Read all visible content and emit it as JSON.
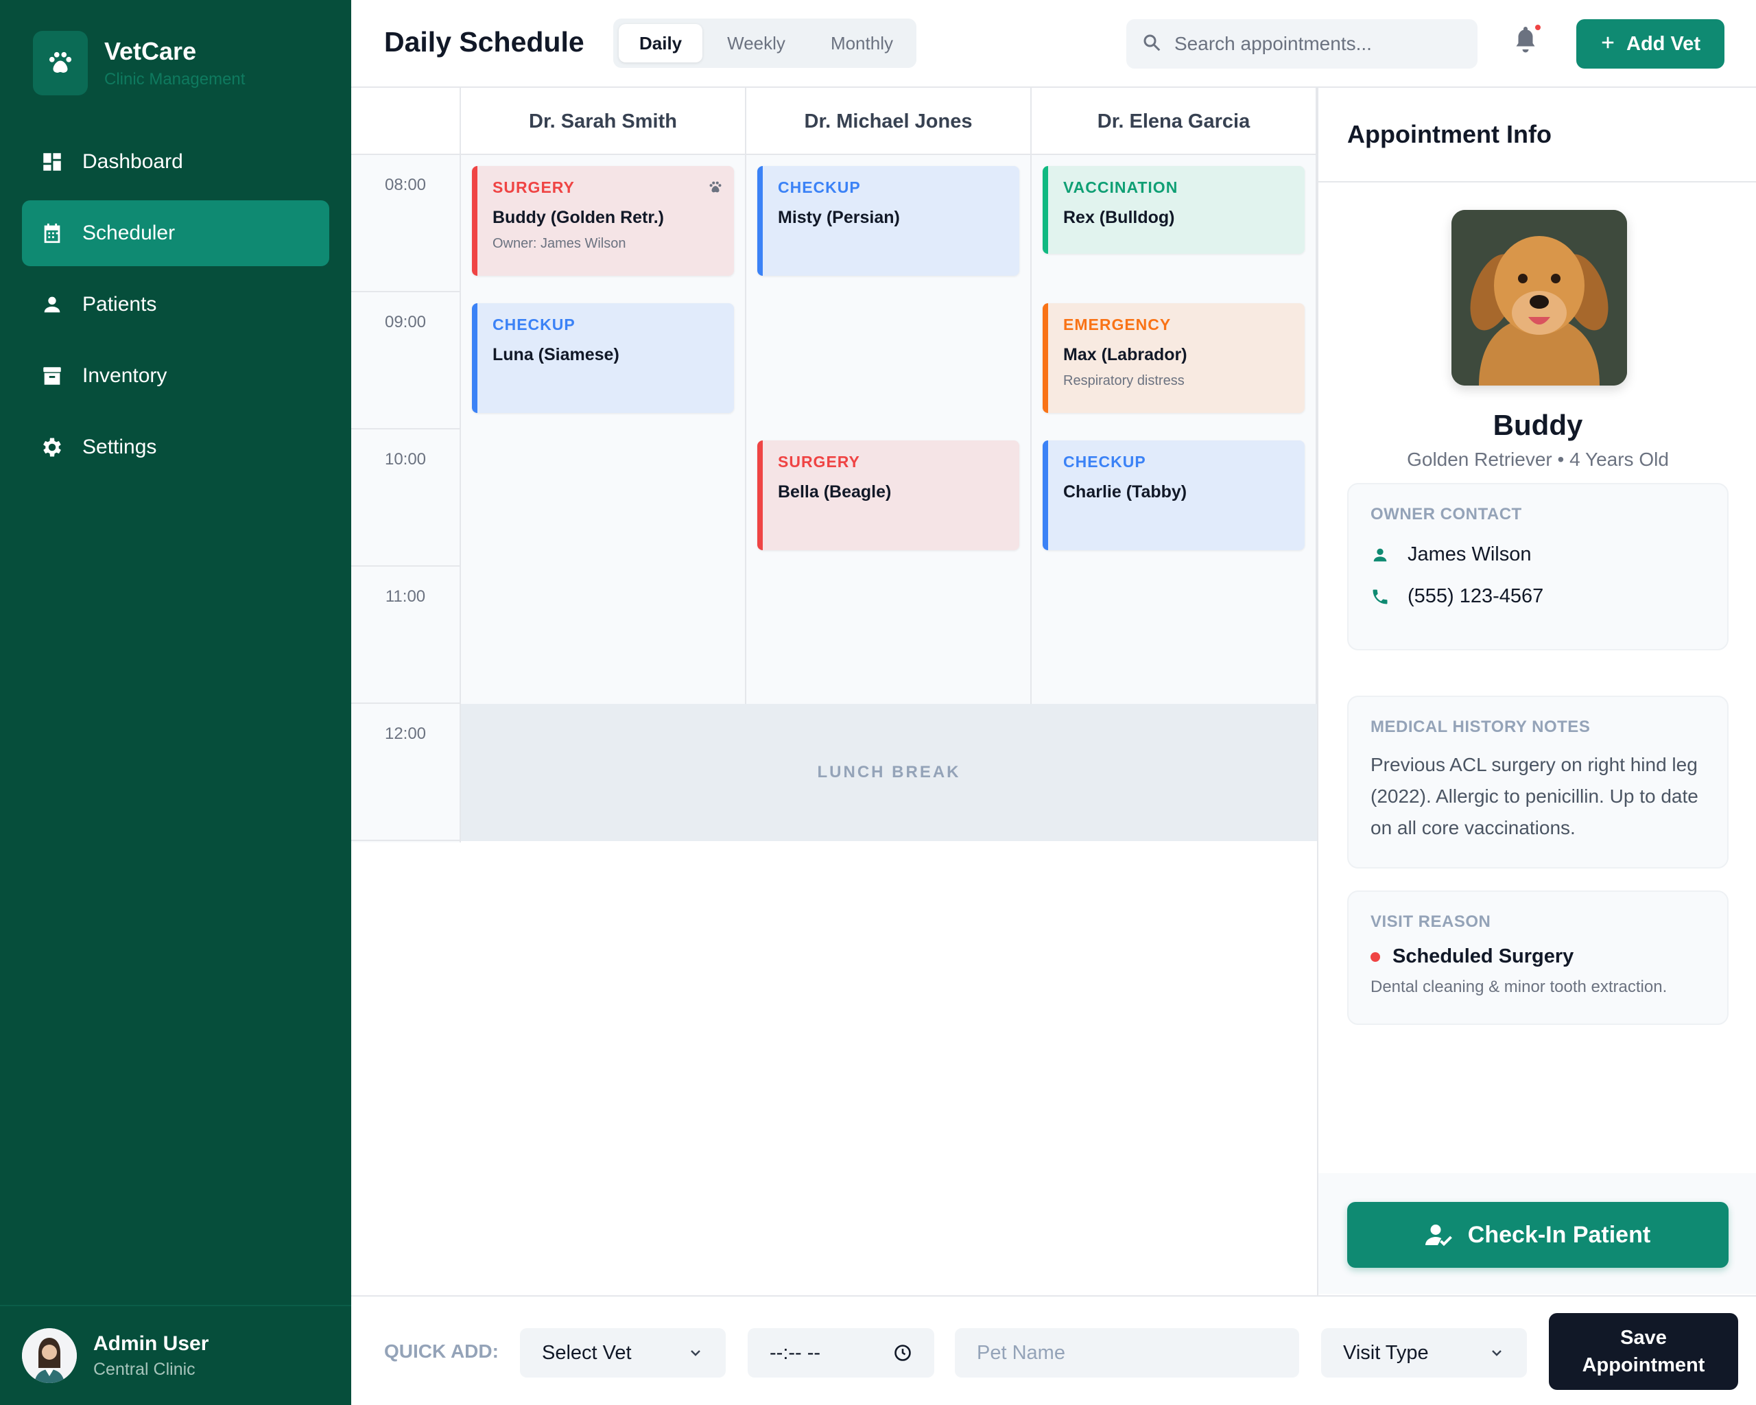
{
  "brand": {
    "title": "VetCare",
    "subtitle": "Clinic Management"
  },
  "nav": [
    {
      "label": "Dashboard",
      "icon": "dashboard-icon",
      "active": false
    },
    {
      "label": "Scheduler",
      "icon": "calendar-icon",
      "active": true
    },
    {
      "label": "Patients",
      "icon": "person-icon",
      "active": false
    },
    {
      "label": "Inventory",
      "icon": "archive-icon",
      "active": false
    },
    {
      "label": "Settings",
      "icon": "gear-icon",
      "active": false
    }
  ],
  "user": {
    "name": "Admin User",
    "location": "Central Clinic"
  },
  "header": {
    "title": "Daily Schedule",
    "views": [
      "Daily",
      "Weekly",
      "Monthly"
    ],
    "active_view": "Daily",
    "search_placeholder": "Search appointments...",
    "add_vet_label": "Add Vet"
  },
  "schedule": {
    "times": [
      "08:00",
      "09:00",
      "10:00",
      "11:00",
      "12:00"
    ],
    "vets": [
      "Dr. Sarah Smith",
      "Dr. Michael Jones",
      "Dr. Elena Garcia"
    ],
    "lunch_label": "LUNCH BREAK",
    "appointments": {
      "sarah_0800": {
        "type": "SURGERY",
        "pet": "Buddy (Golden Retr.)",
        "note": "Owner: James Wilson"
      },
      "michael_0800": {
        "type": "CHECKUP",
        "pet": "Misty (Persian)"
      },
      "elena_0800": {
        "type": "VACCINATION",
        "pet": "Rex (Bulldog)"
      },
      "sarah_0900": {
        "type": "CHECKUP",
        "pet": "Luna (Siamese)"
      },
      "elena_0900": {
        "type": "EMERGENCY",
        "pet": "Max (Labrador)",
        "note": "Respiratory distress"
      },
      "michael_1000": {
        "type": "SURGERY",
        "pet": "Bella (Beagle)"
      },
      "elena_1000": {
        "type": "CHECKUP",
        "pet": "Charlie (Tabby)"
      }
    }
  },
  "panel": {
    "title": "Appointment Info",
    "pet_name": "Buddy",
    "pet_breed": "Golden Retriever",
    "pet_age": "4 Years Old",
    "owner_title": "OWNER CONTACT",
    "owner_name": "James Wilson",
    "owner_phone": "(555) 123-4567",
    "history_title": "MEDICAL HISTORY NOTES",
    "history_text": "Previous ACL surgery on right hind leg (2022). Allergic to penicillin. Up to date on all core vaccinations.",
    "reason_title": "VISIT REASON",
    "reason": "Scheduled Surgery",
    "reason_desc": "Dental cleaning & minor tooth extraction.",
    "checkin_label": "Check-In Patient"
  },
  "quick_add": {
    "label": "QUICK ADD:",
    "vet_select": "Select Vet",
    "time_placeholder": "--:-- --",
    "pet_placeholder": "Pet Name",
    "type_select": "Visit Type",
    "save_label": "Save Appointment"
  },
  "colors": {
    "sidebar": "#064e3b",
    "accent": "#0f8a72",
    "surgery": "#ef4444",
    "checkup": "#3b82f6",
    "vaccination": "#10b981",
    "emergency": "#f97316"
  }
}
